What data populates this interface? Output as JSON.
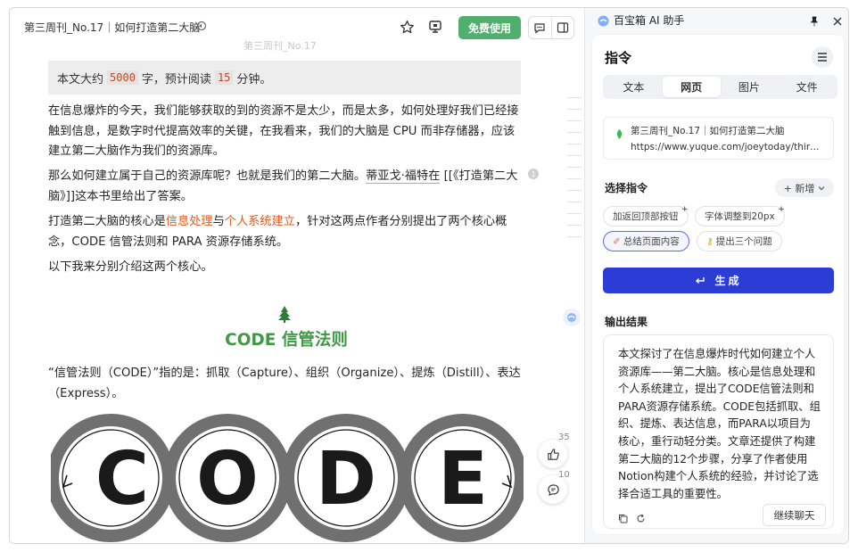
{
  "doc": {
    "title": "第三周刊_No.17｜如何打造第二大脑",
    "free_button": "免费使用",
    "ghost_heading": "第三周刊_No.17",
    "notice": {
      "prefix": "本文大约",
      "words": "5000",
      "mid": "字，预计阅读",
      "minutes": "15",
      "suffix": "分钟。"
    },
    "p1": "在信息爆炸的今天，我们能够获取的到的资源不是太少，而是太多，如何处理好我们已经接触到信息，是数字时代提高效率的关键，在我看来，我们的大脑是 CPU 而非存储器，应该建立第二大脑作为我们的资源库。",
    "p2_a": "那么如何建立属于自己的资源库呢？也就是我们的第二大脑。",
    "p2_u": "蒂亚戈·福特在",
    "p2_b": " [[《打造第二大脑》]]这本书里给出了答案。",
    "comment_count": "1",
    "p3_a": "打造第二大脑的核心是",
    "p3_o1": "信息处理",
    "p3_mid": "与",
    "p3_o2": "个人系统建立",
    "p3_b": "，针对这两点作者分别提出了两个核心概念，CODE 信管法则和 PARA 资源存储系统。",
    "p4": "以下我来分别介绍这两个核心。",
    "section_title": "CODE 信管法则",
    "p5": "“信管法则（CODE）”指的是：抓取（Capture）、组织（Organize）、提炼（Distill）、表达（Express）。",
    "code_letters": [
      "C",
      "O",
      "D",
      "E"
    ],
    "likes": "35",
    "comments": "10"
  },
  "panel": {
    "app_name": "百宝箱 AI 助手",
    "section": "指令",
    "tabs": [
      "文本",
      "网页",
      "图片",
      "文件"
    ],
    "active_tab": 1,
    "source_title": "第三周刊_No.17｜如何打造第二大脑",
    "source_url": "https://www.yuque.com/joeytoday/thirdoption/...",
    "select_label": "选择指令",
    "add_label": "+ 新增",
    "chips": [
      "加返回顶部按钮",
      "字体调整到20px",
      "总结页面内容",
      "提出三个问题"
    ],
    "generate": "生成",
    "output_label": "输出结果",
    "output_text": "本文探讨了在信息爆炸时代如何建立个人资源库——第二大脑。核心是信息处理和个人系统建立，提出了CODE信管法则和PARA资源存储系统。CODE包括抓取、组织、提炼、表达信息，而PARA以项目为核心，重行动轻分类。文章还提供了构建第二大脑的12个步骤，分享了作者使用Notion构建个人系统的经验，并讨论了选择合适工具的重要性。",
    "continue": "继续聊天"
  }
}
